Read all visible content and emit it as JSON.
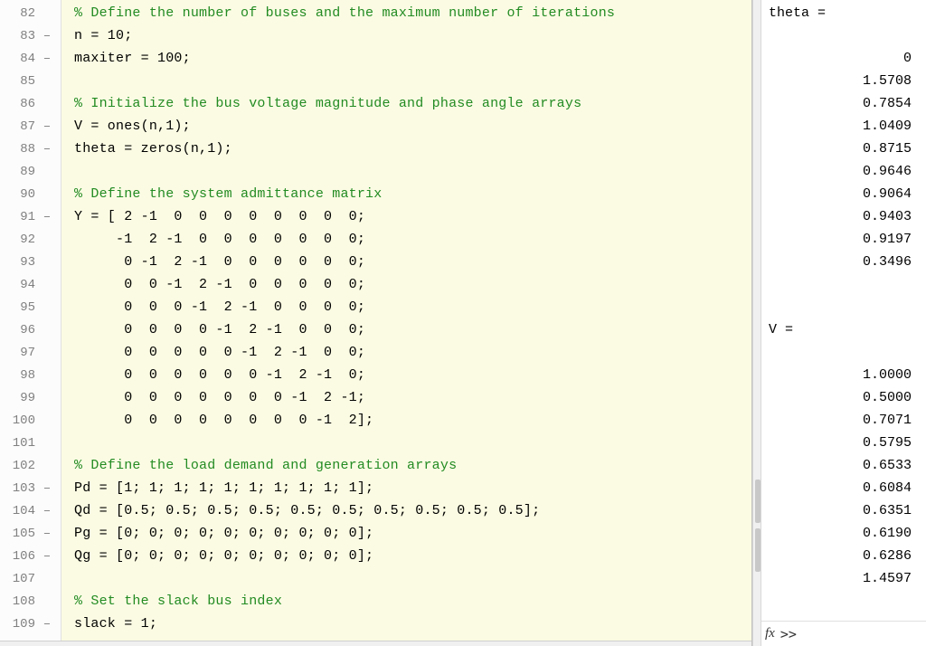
{
  "editor": {
    "lines": [
      {
        "num": "82",
        "mark": "",
        "segs": [
          {
            "cls": "comment",
            "text": "% Define the number of buses and the maximum number of iterations"
          }
        ]
      },
      {
        "num": "83",
        "mark": "–",
        "segs": [
          {
            "cls": "keyword",
            "text": "n = 10;"
          }
        ]
      },
      {
        "num": "84",
        "mark": "–",
        "segs": [
          {
            "cls": "keyword",
            "text": "maxiter = 100;"
          }
        ]
      },
      {
        "num": "85",
        "mark": "",
        "segs": [
          {
            "cls": "",
            "text": ""
          }
        ]
      },
      {
        "num": "86",
        "mark": "",
        "segs": [
          {
            "cls": "comment",
            "text": "% Initialize the bus voltage magnitude and phase angle arrays"
          }
        ]
      },
      {
        "num": "87",
        "mark": "–",
        "segs": [
          {
            "cls": "keyword",
            "text": "V = ones(n,1);"
          }
        ]
      },
      {
        "num": "88",
        "mark": "–",
        "segs": [
          {
            "cls": "keyword",
            "text": "theta = zeros(n,1);"
          }
        ]
      },
      {
        "num": "89",
        "mark": "",
        "segs": [
          {
            "cls": "",
            "text": ""
          }
        ]
      },
      {
        "num": "90",
        "mark": "",
        "segs": [
          {
            "cls": "comment",
            "text": "% Define the system admittance matrix"
          }
        ]
      },
      {
        "num": "91",
        "mark": "–",
        "segs": [
          {
            "cls": "keyword",
            "text": "Y = [ 2 -1  0  0  0  0  0  0  0  0;"
          }
        ]
      },
      {
        "num": "92",
        "mark": "",
        "segs": [
          {
            "cls": "keyword",
            "text": "     -1  2 -1  0  0  0  0  0  0  0;"
          }
        ]
      },
      {
        "num": "93",
        "mark": "",
        "segs": [
          {
            "cls": "keyword",
            "text": "      0 -1  2 -1  0  0  0  0  0  0;"
          }
        ]
      },
      {
        "num": "94",
        "mark": "",
        "segs": [
          {
            "cls": "keyword",
            "text": "      0  0 -1  2 -1  0  0  0  0  0;"
          }
        ]
      },
      {
        "num": "95",
        "mark": "",
        "segs": [
          {
            "cls": "keyword",
            "text": "      0  0  0 -1  2 -1  0  0  0  0;"
          }
        ]
      },
      {
        "num": "96",
        "mark": "",
        "segs": [
          {
            "cls": "keyword",
            "text": "      0  0  0  0 -1  2 -1  0  0  0;"
          }
        ]
      },
      {
        "num": "97",
        "mark": "",
        "segs": [
          {
            "cls": "keyword",
            "text": "      0  0  0  0  0 -1  2 -1  0  0;"
          }
        ]
      },
      {
        "num": "98",
        "mark": "",
        "segs": [
          {
            "cls": "keyword",
            "text": "      0  0  0  0  0  0 -1  2 -1  0;"
          }
        ]
      },
      {
        "num": "99",
        "mark": "",
        "segs": [
          {
            "cls": "keyword",
            "text": "      0  0  0  0  0  0  0 -1  2 -1;"
          }
        ]
      },
      {
        "num": "100",
        "mark": "",
        "segs": [
          {
            "cls": "keyword",
            "text": "      0  0  0  0  0  0  0  0 -1  2];"
          }
        ]
      },
      {
        "num": "101",
        "mark": "",
        "segs": [
          {
            "cls": "",
            "text": ""
          }
        ]
      },
      {
        "num": "102",
        "mark": "",
        "segs": [
          {
            "cls": "comment",
            "text": "% Define the load demand and generation arrays"
          }
        ]
      },
      {
        "num": "103",
        "mark": "–",
        "segs": [
          {
            "cls": "keyword",
            "text": "Pd = [1; 1; 1; 1; 1; 1; 1; 1; 1; 1];"
          }
        ]
      },
      {
        "num": "104",
        "mark": "–",
        "segs": [
          {
            "cls": "keyword",
            "text": "Qd = [0.5; 0.5; 0.5; 0.5; 0.5; 0.5; 0.5; 0.5; 0.5; 0.5];"
          }
        ]
      },
      {
        "num": "105",
        "mark": "–",
        "segs": [
          {
            "cls": "keyword",
            "text": "Pg = [0; 0; 0; 0; 0; 0; 0; 0; 0; 0];"
          }
        ]
      },
      {
        "num": "106",
        "mark": "–",
        "segs": [
          {
            "cls": "keyword",
            "text": "Qg = [0; 0; 0; 0; 0; 0; 0; 0; 0; 0];"
          }
        ]
      },
      {
        "num": "107",
        "mark": "",
        "segs": [
          {
            "cls": "",
            "text": ""
          }
        ]
      },
      {
        "num": "108",
        "mark": "",
        "segs": [
          {
            "cls": "comment",
            "text": "% Set the slack bus index"
          }
        ]
      },
      {
        "num": "109",
        "mark": "–",
        "segs": [
          {
            "cls": "keyword",
            "text": "slack = 1;"
          }
        ]
      }
    ]
  },
  "command": {
    "lines": [
      {
        "text": "theta =",
        "align": "left"
      },
      {
        "text": "",
        "align": "left"
      },
      {
        "text": "0",
        "align": "right"
      },
      {
        "text": "1.5708",
        "align": "right"
      },
      {
        "text": "0.7854",
        "align": "right"
      },
      {
        "text": "1.0409",
        "align": "right"
      },
      {
        "text": "0.8715",
        "align": "right"
      },
      {
        "text": "0.9646",
        "align": "right"
      },
      {
        "text": "0.9064",
        "align": "right"
      },
      {
        "text": "0.9403",
        "align": "right"
      },
      {
        "text": "0.9197",
        "align": "right"
      },
      {
        "text": "0.3496",
        "align": "right"
      },
      {
        "text": "",
        "align": "left"
      },
      {
        "text": "",
        "align": "left"
      },
      {
        "text": "V =",
        "align": "left"
      },
      {
        "text": "",
        "align": "left"
      },
      {
        "text": "1.0000",
        "align": "right"
      },
      {
        "text": "0.5000",
        "align": "right"
      },
      {
        "text": "0.7071",
        "align": "right"
      },
      {
        "text": "0.5795",
        "align": "right"
      },
      {
        "text": "0.6533",
        "align": "right"
      },
      {
        "text": "0.6084",
        "align": "right"
      },
      {
        "text": "0.6351",
        "align": "right"
      },
      {
        "text": "0.6190",
        "align": "right"
      },
      {
        "text": "0.6286",
        "align": "right"
      },
      {
        "text": "1.4597",
        "align": "right"
      },
      {
        "text": "",
        "align": "left"
      }
    ],
    "fx_label": "fx",
    "prompt": ">> "
  },
  "chart_data": {
    "type": "table",
    "title": "MATLAB variables",
    "series": [
      {
        "name": "theta",
        "values": [
          0,
          1.5708,
          0.7854,
          1.0409,
          0.8715,
          0.9646,
          0.9064,
          0.9403,
          0.9197,
          0.3496
        ]
      },
      {
        "name": "V",
        "values": [
          1.0,
          0.5,
          0.7071,
          0.5795,
          0.6533,
          0.6084,
          0.6351,
          0.619,
          0.6286,
          1.4597
        ]
      }
    ]
  }
}
